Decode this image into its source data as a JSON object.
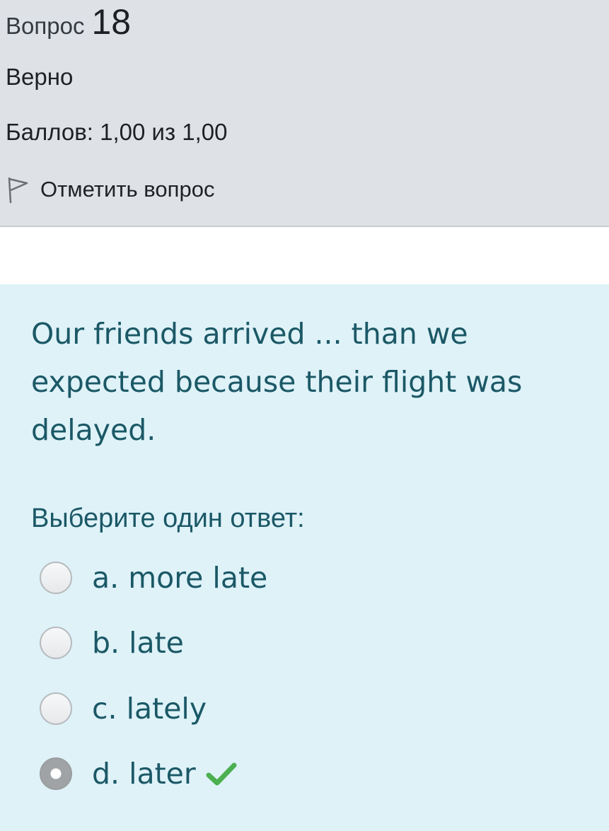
{
  "info": {
    "question_word": "Вопрос",
    "question_number": "18",
    "state": "Верно",
    "grade": "Баллов: 1,00 из 1,00",
    "flag_label": "Отметить вопрос",
    "flag_icon": "flag-outline-icon"
  },
  "question": {
    "text": "Our friends arrived ... than we expected because their flight was delayed.",
    "prompt": "Выберите один ответ:",
    "options": [
      {
        "label": "a. more late",
        "selected": false
      },
      {
        "label": "b. late",
        "selected": false
      },
      {
        "label": "c. lately",
        "selected": false
      },
      {
        "label": "d. later",
        "selected": true,
        "marked_correct": true
      }
    ]
  },
  "colors": {
    "info_bg": "#dee2e6",
    "question_bg": "#def2f8",
    "question_text": "#1b5866",
    "correct_check": "#4caf50"
  }
}
